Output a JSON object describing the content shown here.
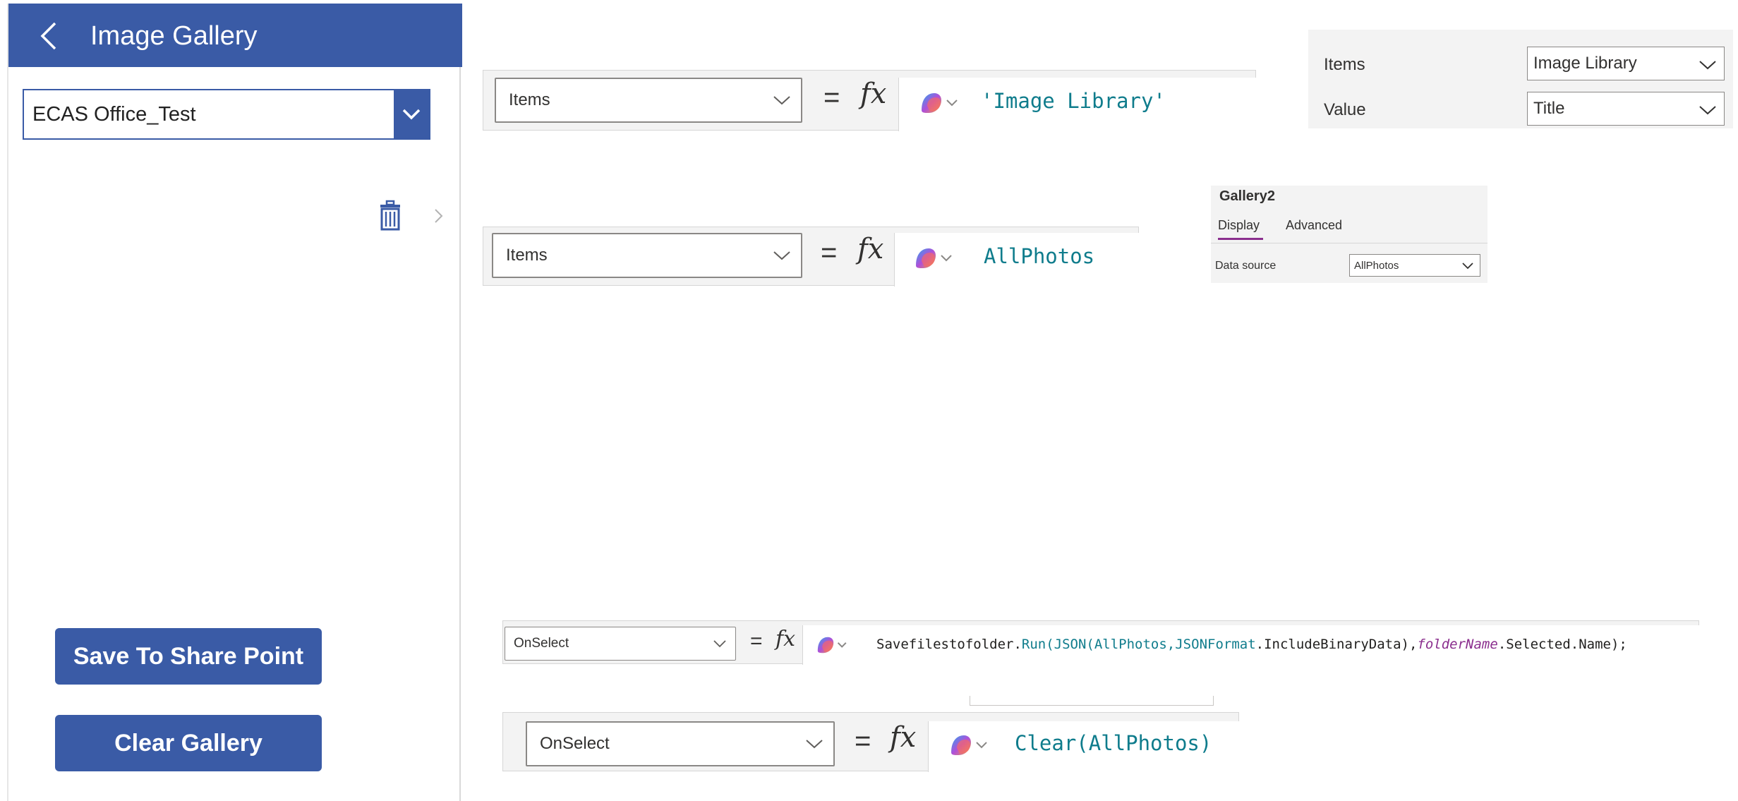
{
  "app": {
    "title": "Image Gallery",
    "folder_dropdown_value": "ECAS Office_Test",
    "save_button": "Save To Share Point",
    "clear_button": "Clear Gallery"
  },
  "formula_items_library": {
    "property": "Items",
    "equals": "=",
    "fx": "fx",
    "code": "'Image Library'"
  },
  "formula_items_gallery": {
    "property": "Items",
    "equals": "=",
    "fx": "fx",
    "code": "AllPhotos"
  },
  "dropdown_props": {
    "items_label": "Items",
    "items_value": "Image Library",
    "value_label": "Value",
    "value_value": "Title"
  },
  "gallery_props": {
    "name": "Gallery2",
    "tab_display": "Display",
    "tab_advanced": "Advanced",
    "data_source_label": "Data source",
    "data_source_value": "AllPhotos"
  },
  "formula_save": {
    "property": "OnSelect",
    "equals": "=",
    "fx": "fx",
    "code_part1": "Savefilestofolder.",
    "code_part2": "Run(JSON(AllPhotos,JSONFormat",
    "code_part3": ".IncludeBinaryData),",
    "code_part4": "folderName",
    "code_part5": ".Selected.Name);"
  },
  "formula_clear": {
    "property": "OnSelect",
    "equals": "=",
    "fx": "fx",
    "code": "Clear(AllPhotos)"
  },
  "colors": {
    "accent": "#3a5ba6",
    "code_teal": "#0f7c8c",
    "code_purple": "#8b2f8e"
  }
}
